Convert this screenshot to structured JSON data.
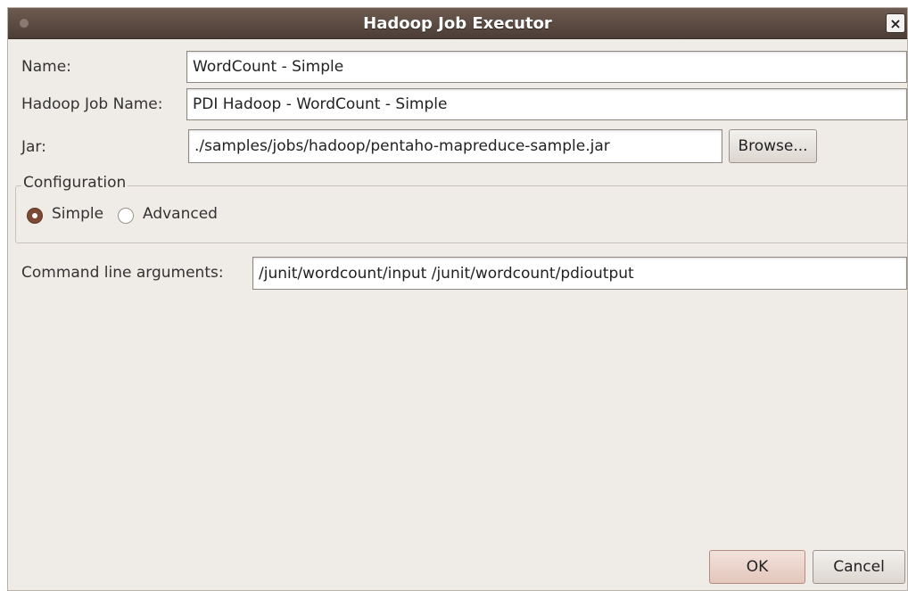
{
  "window": {
    "title": "Hadoop Job Executor",
    "close_label": "×"
  },
  "form": {
    "name_label": "Name:",
    "name_value": "WordCount - Simple",
    "job_name_label": "Hadoop Job Name:",
    "job_name_value": "PDI Hadoop - WordCount - Simple",
    "jar_label": "Jar:",
    "jar_value": "./samples/jobs/hadoop/pentaho-mapreduce-sample.jar",
    "browse_label": "Browse...",
    "args_label": "Command line arguments:",
    "args_value": "/junit/wordcount/input /junit/wordcount/pdioutput"
  },
  "configuration": {
    "title": "Configuration",
    "options": [
      {
        "label": "Simple",
        "selected": true
      },
      {
        "label": "Advanced",
        "selected": false
      }
    ]
  },
  "buttons": {
    "ok": "OK",
    "cancel": "Cancel"
  },
  "colors": {
    "titlebar": "#5a4a42",
    "accent": "#7a4a35",
    "dialog_bg": "#efebe7"
  }
}
